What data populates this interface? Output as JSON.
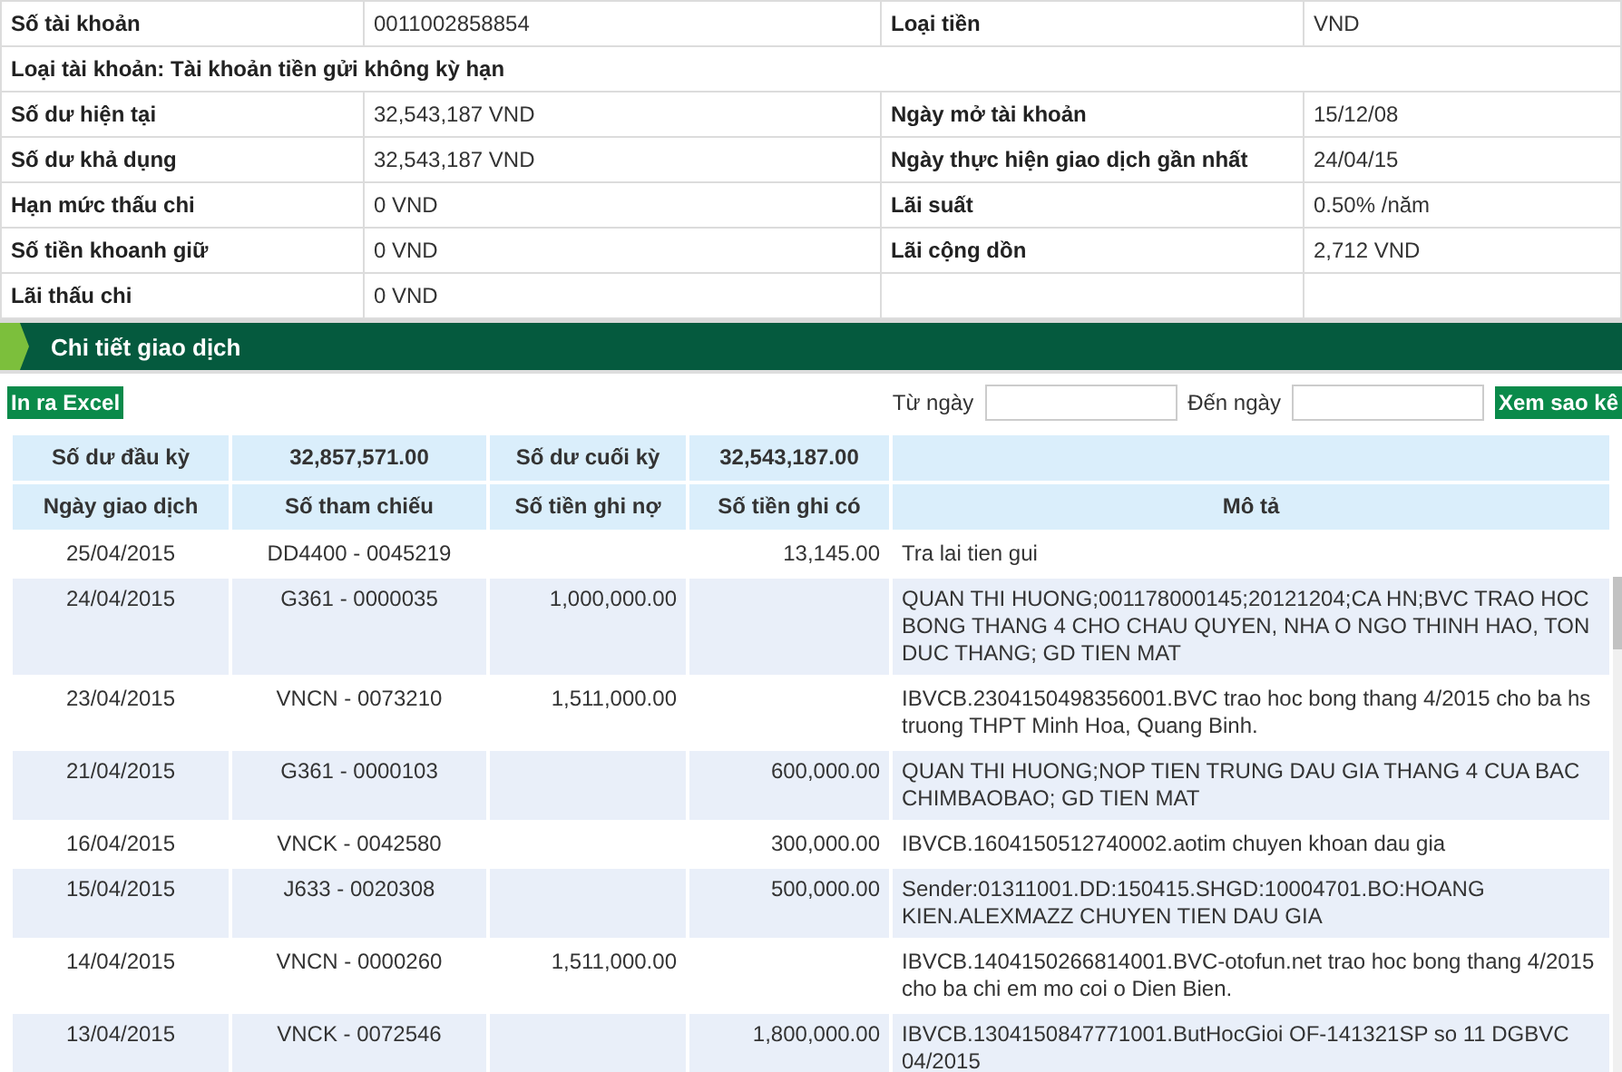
{
  "account_info": [
    {
      "kind": "pair",
      "label": "Số tài khoản",
      "value": "0011002858854",
      "label_2": "Loại tiền",
      "value_2": "VND"
    },
    {
      "kind": "wide",
      "label": "Loại tài khoản: Tài khoản tiền gửi không kỳ hạn"
    },
    {
      "kind": "pair",
      "label": "Số dư hiện tại",
      "value": "32,543,187 VND",
      "label_2": "Ngày mở tài khoản",
      "value_2": "15/12/08"
    },
    {
      "kind": "pair",
      "label": "Số dư khả dụng",
      "value": "32,543,187 VND",
      "label_2": "Ngày thực hiện giao dịch gần nhất",
      "value_2": "24/04/15"
    },
    {
      "kind": "pair",
      "label": "Hạn mức thấu chi",
      "value": "0 VND",
      "label_2": "Lãi suất",
      "value_2": "0.50% /năm"
    },
    {
      "kind": "pair",
      "label": "Số tiền khoanh giữ",
      "value": "0 VND",
      "label_2": "Lãi cộng dồn",
      "value_2": "2,712 VND"
    },
    {
      "kind": "pair",
      "label": "Lãi thấu chi",
      "value": "0 VND"
    }
  ],
  "section_title": "Chi tiết giao dịch",
  "toolbar": {
    "export_button": "In ra Excel",
    "from_label": "Từ ngày",
    "to_label": "Đến ngày",
    "view_button": "Xem sao kê"
  },
  "summary": {
    "opening_label": "Số dư đầu kỳ",
    "opening_value": "32,857,571.00",
    "closing_label": "Số dư cuối kỳ",
    "closing_value": "32,543,187.00"
  },
  "table": {
    "columns": [
      "Ngày giao dịch",
      "Số tham chiếu",
      "Số tiền ghi nợ",
      "Số tiền ghi có",
      "Mô tả"
    ],
    "rows": [
      {
        "date": "25/04/2015",
        "ref": "DD4400 - 0045219",
        "credit": "13,145.00",
        "description": "Tra lai tien gui"
      },
      {
        "date": "24/04/2015",
        "ref": "G361 - 0000035",
        "debit": "1,000,000.00",
        "description": "QUAN THI HUONG;001178000145;20121204;CA HN;BVC TRAO HOC BONG THANG 4 CHO CHAU QUYEN, NHA O NGO THINH HAO, TON DUC THANG; GD TIEN MAT"
      },
      {
        "date": "23/04/2015",
        "ref": "VNCN - 0073210",
        "debit": "1,511,000.00",
        "description": "IBVCB.2304150498356001.BVC trao hoc bong thang 4/2015 cho ba hs truong THPT Minh Hoa, Quang Binh."
      },
      {
        "date": "21/04/2015",
        "ref": "G361 - 0000103",
        "credit": "600,000.00",
        "description": "QUAN THI HUONG;NOP TIEN TRUNG DAU GIA THANG 4 CUA BAC CHIMBAOBAO; GD TIEN MAT"
      },
      {
        "date": "16/04/2015",
        "ref": "VNCK - 0042580",
        "credit": "300,000.00",
        "description": "IBVCB.1604150512740002.aotim chuyen khoan dau gia"
      },
      {
        "date": "15/04/2015",
        "ref": "J633 - 0020308",
        "credit": "500,000.00",
        "description": "Sender:01311001.DD:150415.SHGD:10004701.BO:HOANG KIEN.ALEXMAZZ CHUYEN TIEN DAU GIA"
      },
      {
        "date": "14/04/2015",
        "ref": "VNCN - 0000260",
        "debit": "1,511,000.00",
        "description": "IBVCB.1404150266814001.BVC-otofun.net trao hoc bong thang 4/2015 cho ba chi em mo coi o Dien Bien."
      },
      {
        "date": "13/04/2015",
        "ref": "VNCK - 0072546",
        "credit": "1,800,000.00",
        "description": "IBVCB.1304150847771001.ButHocGioi OF-141321SP so 11 DGBVC 04/2015"
      }
    ]
  }
}
